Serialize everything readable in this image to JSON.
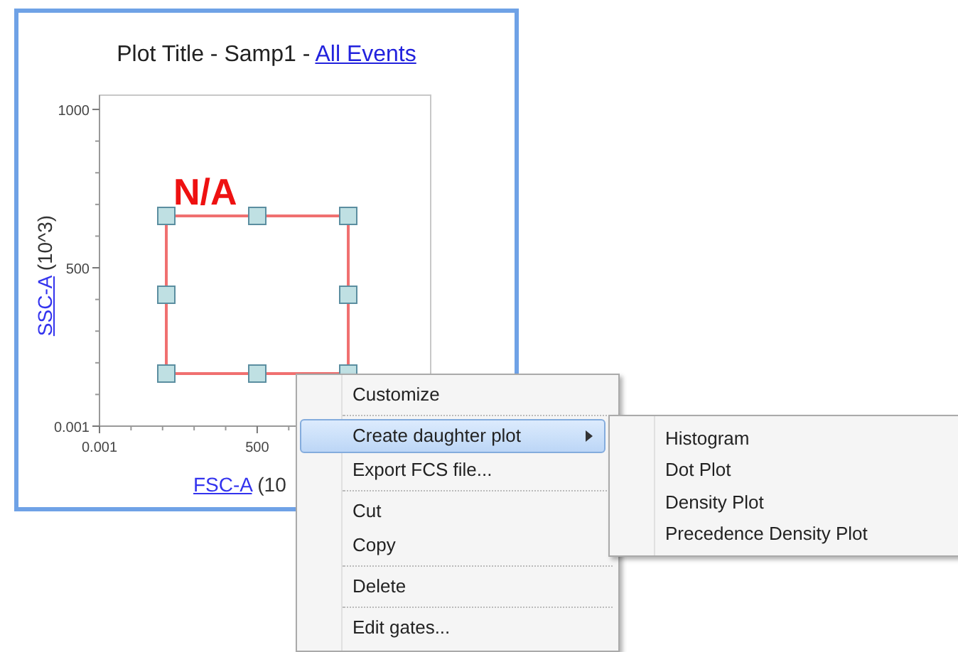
{
  "plot": {
    "title": "Plot Title - Samp1 - ",
    "title_link": "All Events",
    "gate_label": "N/A",
    "x_axis": {
      "link": "FSC-A",
      "unit": "(10"
    },
    "y_axis": {
      "link": "SSC-A",
      "unit": "(10^3)"
    },
    "chart_data": {
      "type": "scatter",
      "xlim": [
        0.001,
        1050
      ],
      "ylim": [
        0.001,
        1045
      ],
      "xticks": [
        0.001,
        500
      ],
      "yticks": [
        0.001,
        500,
        1000
      ]
    }
  },
  "context_menu": {
    "items": [
      {
        "kind": "item",
        "label": "Customize",
        "selected": false,
        "submenu": false
      },
      {
        "kind": "separator"
      },
      {
        "kind": "item",
        "label": "Create daughter plot",
        "selected": true,
        "submenu": true
      },
      {
        "kind": "item",
        "label": "Export FCS file...",
        "selected": false,
        "submenu": false
      },
      {
        "kind": "separator"
      },
      {
        "kind": "item",
        "label": "Cut",
        "selected": false,
        "submenu": false
      },
      {
        "kind": "item",
        "label": "Copy",
        "selected": false,
        "submenu": false
      },
      {
        "kind": "separator"
      },
      {
        "kind": "item",
        "label": "Delete",
        "selected": false,
        "submenu": false
      },
      {
        "kind": "separator"
      },
      {
        "kind": "item",
        "label": "Edit gates...",
        "selected": false,
        "submenu": false
      }
    ]
  },
  "submenu": {
    "items": [
      {
        "label": "Histogram",
        "selected": false
      },
      {
        "label": "Dot Plot",
        "selected": false
      },
      {
        "label": "Density Plot",
        "selected": false
      },
      {
        "label": "Precedence Density Plot",
        "selected": false
      }
    ]
  }
}
